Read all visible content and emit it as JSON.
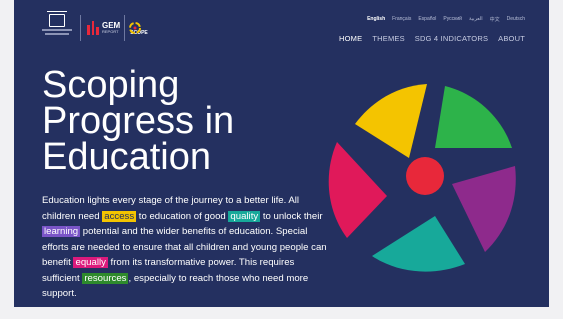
{
  "header": {
    "logos": {
      "unesco": "UNESCO",
      "gem_label": "GEM",
      "gem_sub": "REPORT",
      "scope_label": "SCOPE"
    },
    "languages": [
      {
        "label": "English",
        "active": true
      },
      {
        "label": "Français",
        "active": false
      },
      {
        "label": "Español",
        "active": false
      },
      {
        "label": "Русский",
        "active": false
      },
      {
        "label": "العربية",
        "active": false
      },
      {
        "label": "中文",
        "active": false
      },
      {
        "label": "Deutsch",
        "active": false
      }
    ],
    "nav": [
      {
        "label": "HOME",
        "active": true
      },
      {
        "label": "THEMES",
        "active": false
      },
      {
        "label": "SDG 4 INDICATORS",
        "active": false
      },
      {
        "label": "ABOUT",
        "active": false
      }
    ]
  },
  "hero": {
    "title_lines": [
      "Scoping",
      "Progress in",
      "Education"
    ],
    "intro": {
      "t1": "Education lights every stage of the journey to a better life. All children need ",
      "h1": "access",
      "t2": " to education of good ",
      "h2": "quality",
      "t3": " to unlock their ",
      "h3": "learning",
      "t4": " potential and the wider benefits of education. Special efforts are needed to ensure that all children and young people can benefit ",
      "h4": "equally",
      "t5": " from its transformative power. This requires sufficient ",
      "h5": "resources",
      "t6": ", especially to reach those who need more support."
    }
  },
  "colors": {
    "background": "#243060",
    "yellow": "#f4c400",
    "green": "#2db34a",
    "purple": "#8e2a8c",
    "teal": "#17a99a",
    "pink": "#e0195a",
    "center": "#e8283a"
  }
}
